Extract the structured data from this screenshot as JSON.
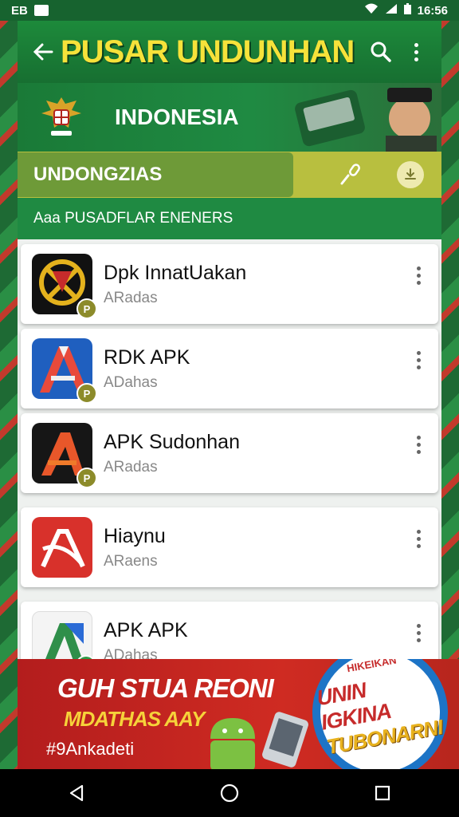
{
  "status_bar": {
    "left_text": "EB",
    "time": "16:56"
  },
  "toolbar": {
    "title": "PUSAR UNDUNHAN",
    "back_icon": "arrow-back-icon",
    "search_icon": "search-icon",
    "menu_icon": "more-vert-icon"
  },
  "hero": {
    "title": "INDONESIA"
  },
  "search": {
    "value": "UNDONGZIAS",
    "mic_icon": "microphone-icon",
    "action_icon": "download-icon"
  },
  "section": {
    "title": "Aaa  PUSADFLAR ENENERS"
  },
  "apps": [
    {
      "title": "Dpk InnatUakan",
      "subtitle": "ARadas",
      "badge": "P",
      "icon": "app-icon-dark"
    },
    {
      "title": "RDK APK",
      "subtitle": "ADahas",
      "badge": "P",
      "icon": "app-icon-blue"
    },
    {
      "title": "APK Sudonhan",
      "subtitle": "ARadas",
      "badge": "P",
      "icon": "app-icon-black"
    },
    {
      "title": "Hiaynu",
      "subtitle": "ARaens",
      "badge": "",
      "icon": "app-icon-red"
    },
    {
      "title": "APK APK",
      "subtitle": "ADahas",
      "badge": "",
      "icon": "app-icon-white"
    }
  ],
  "ad": {
    "headline": "GUH STUA REONI",
    "subline": "MDATHAS AAY",
    "tag": "#9Ankadeti",
    "circle_top": "HIKEIKAN",
    "circle_line1": "UNIN IGKINA",
    "circle_line2": "TUBONARNI"
  },
  "colors": {
    "primary": "#1d8a3b",
    "accent": "#f6e23a",
    "ad_red": "#c62b2b"
  }
}
